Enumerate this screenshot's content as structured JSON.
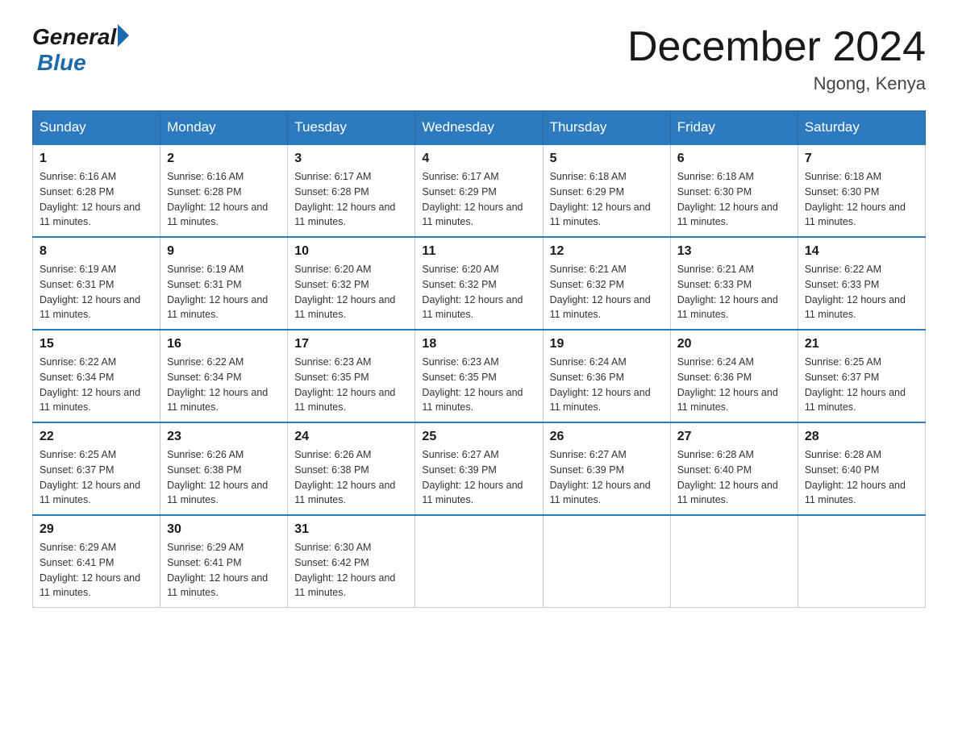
{
  "header": {
    "logo_general": "General",
    "logo_blue": "Blue",
    "title": "December 2024",
    "location": "Ngong, Kenya"
  },
  "days_of_week": [
    "Sunday",
    "Monday",
    "Tuesday",
    "Wednesday",
    "Thursday",
    "Friday",
    "Saturday"
  ],
  "weeks": [
    [
      {
        "day": "1",
        "sunrise": "6:16 AM",
        "sunset": "6:28 PM",
        "daylight": "12 hours and 11 minutes."
      },
      {
        "day": "2",
        "sunrise": "6:16 AM",
        "sunset": "6:28 PM",
        "daylight": "12 hours and 11 minutes."
      },
      {
        "day": "3",
        "sunrise": "6:17 AM",
        "sunset": "6:28 PM",
        "daylight": "12 hours and 11 minutes."
      },
      {
        "day": "4",
        "sunrise": "6:17 AM",
        "sunset": "6:29 PM",
        "daylight": "12 hours and 11 minutes."
      },
      {
        "day": "5",
        "sunrise": "6:18 AM",
        "sunset": "6:29 PM",
        "daylight": "12 hours and 11 minutes."
      },
      {
        "day": "6",
        "sunrise": "6:18 AM",
        "sunset": "6:30 PM",
        "daylight": "12 hours and 11 minutes."
      },
      {
        "day": "7",
        "sunrise": "6:18 AM",
        "sunset": "6:30 PM",
        "daylight": "12 hours and 11 minutes."
      }
    ],
    [
      {
        "day": "8",
        "sunrise": "6:19 AM",
        "sunset": "6:31 PM",
        "daylight": "12 hours and 11 minutes."
      },
      {
        "day": "9",
        "sunrise": "6:19 AM",
        "sunset": "6:31 PM",
        "daylight": "12 hours and 11 minutes."
      },
      {
        "day": "10",
        "sunrise": "6:20 AM",
        "sunset": "6:32 PM",
        "daylight": "12 hours and 11 minutes."
      },
      {
        "day": "11",
        "sunrise": "6:20 AM",
        "sunset": "6:32 PM",
        "daylight": "12 hours and 11 minutes."
      },
      {
        "day": "12",
        "sunrise": "6:21 AM",
        "sunset": "6:32 PM",
        "daylight": "12 hours and 11 minutes."
      },
      {
        "day": "13",
        "sunrise": "6:21 AM",
        "sunset": "6:33 PM",
        "daylight": "12 hours and 11 minutes."
      },
      {
        "day": "14",
        "sunrise": "6:22 AM",
        "sunset": "6:33 PM",
        "daylight": "12 hours and 11 minutes."
      }
    ],
    [
      {
        "day": "15",
        "sunrise": "6:22 AM",
        "sunset": "6:34 PM",
        "daylight": "12 hours and 11 minutes."
      },
      {
        "day": "16",
        "sunrise": "6:22 AM",
        "sunset": "6:34 PM",
        "daylight": "12 hours and 11 minutes."
      },
      {
        "day": "17",
        "sunrise": "6:23 AM",
        "sunset": "6:35 PM",
        "daylight": "12 hours and 11 minutes."
      },
      {
        "day": "18",
        "sunrise": "6:23 AM",
        "sunset": "6:35 PM",
        "daylight": "12 hours and 11 minutes."
      },
      {
        "day": "19",
        "sunrise": "6:24 AM",
        "sunset": "6:36 PM",
        "daylight": "12 hours and 11 minutes."
      },
      {
        "day": "20",
        "sunrise": "6:24 AM",
        "sunset": "6:36 PM",
        "daylight": "12 hours and 11 minutes."
      },
      {
        "day": "21",
        "sunrise": "6:25 AM",
        "sunset": "6:37 PM",
        "daylight": "12 hours and 11 minutes."
      }
    ],
    [
      {
        "day": "22",
        "sunrise": "6:25 AM",
        "sunset": "6:37 PM",
        "daylight": "12 hours and 11 minutes."
      },
      {
        "day": "23",
        "sunrise": "6:26 AM",
        "sunset": "6:38 PM",
        "daylight": "12 hours and 11 minutes."
      },
      {
        "day": "24",
        "sunrise": "6:26 AM",
        "sunset": "6:38 PM",
        "daylight": "12 hours and 11 minutes."
      },
      {
        "day": "25",
        "sunrise": "6:27 AM",
        "sunset": "6:39 PM",
        "daylight": "12 hours and 11 minutes."
      },
      {
        "day": "26",
        "sunrise": "6:27 AM",
        "sunset": "6:39 PM",
        "daylight": "12 hours and 11 minutes."
      },
      {
        "day": "27",
        "sunrise": "6:28 AM",
        "sunset": "6:40 PM",
        "daylight": "12 hours and 11 minutes."
      },
      {
        "day": "28",
        "sunrise": "6:28 AM",
        "sunset": "6:40 PM",
        "daylight": "12 hours and 11 minutes."
      }
    ],
    [
      {
        "day": "29",
        "sunrise": "6:29 AM",
        "sunset": "6:41 PM",
        "daylight": "12 hours and 11 minutes."
      },
      {
        "day": "30",
        "sunrise": "6:29 AM",
        "sunset": "6:41 PM",
        "daylight": "12 hours and 11 minutes."
      },
      {
        "day": "31",
        "sunrise": "6:30 AM",
        "sunset": "6:42 PM",
        "daylight": "12 hours and 11 minutes."
      },
      null,
      null,
      null,
      null
    ]
  ],
  "labels": {
    "sunrise_prefix": "Sunrise: ",
    "sunset_prefix": "Sunset: ",
    "daylight_prefix": "Daylight: "
  }
}
